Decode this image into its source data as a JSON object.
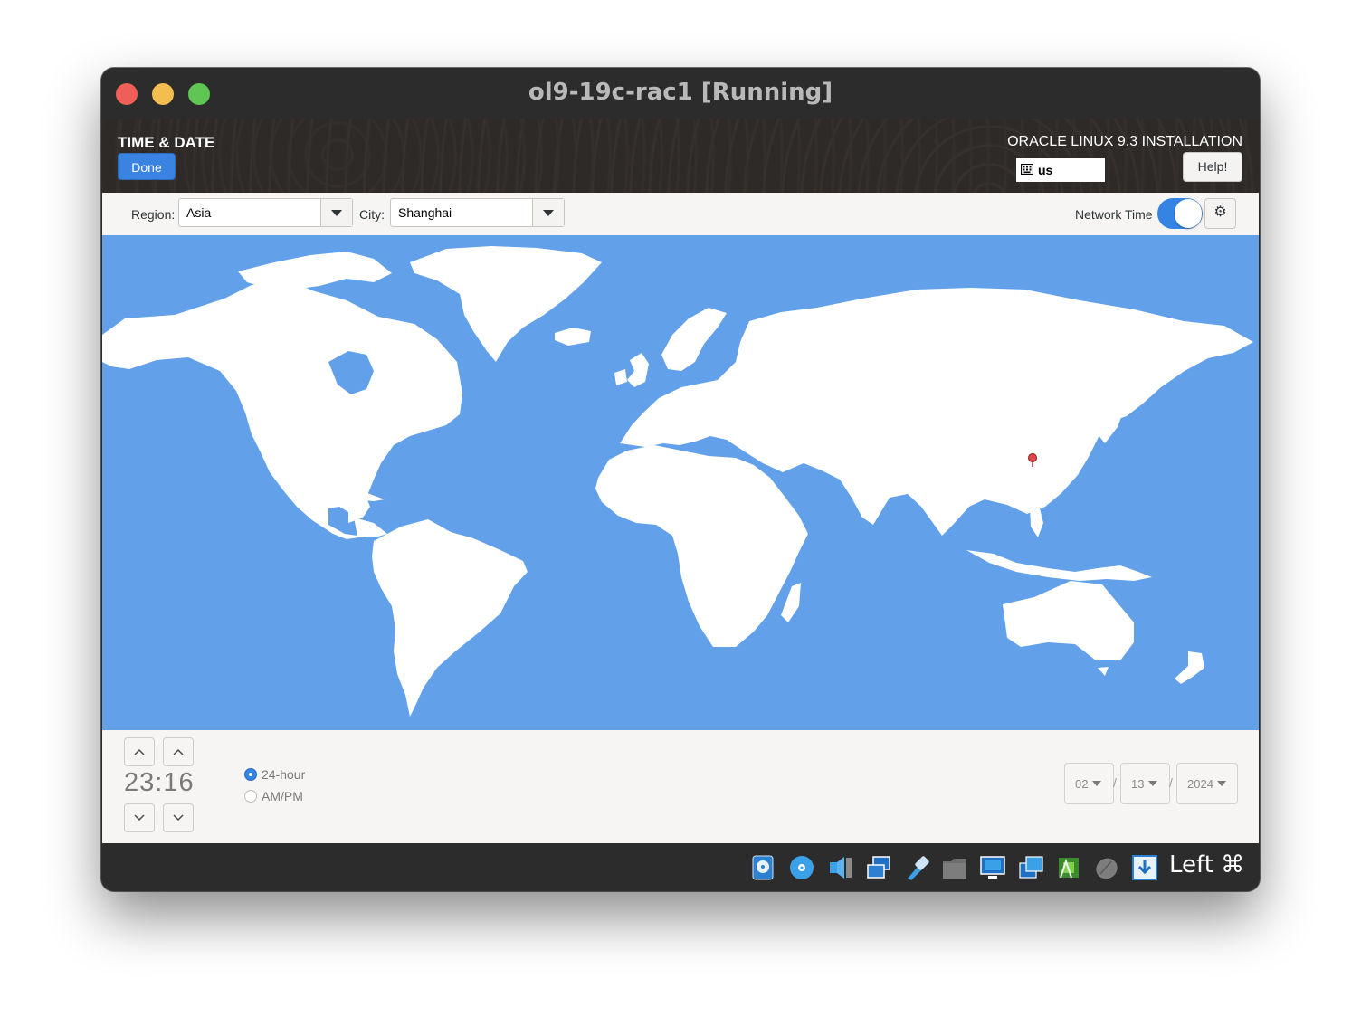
{
  "window": {
    "title": "ol9-19c-rac1 [Running]"
  },
  "header": {
    "spoke_title": "TIME & DATE",
    "done_label": "Done",
    "product_title": "ORACLE LINUX 9.3 INSTALLATION",
    "keyboard_layout": "us",
    "help_label": "Help!"
  },
  "toolbar": {
    "region_label": "Region:",
    "region_value": "Asia",
    "city_label": "City:",
    "city_value": "Shanghai",
    "network_time_label": "Network Time",
    "network_time_on": true
  },
  "map": {
    "selected_city": "Shanghai",
    "ocean_color": "#62a0ea",
    "land_color": "#ffffff",
    "pin_color": "#e0474c"
  },
  "time": {
    "hours": "23",
    "separator": ":",
    "minutes": "16",
    "format_24h_label": "24-hour",
    "format_ampm_label": "AM/PM",
    "selected_format": "24-hour"
  },
  "date": {
    "month": "02",
    "day": "13",
    "year": "2024",
    "separator": "/"
  },
  "statusbar": {
    "icons": [
      "hard-disk-icon",
      "optical-drive-icon",
      "audio-icon",
      "network-icon",
      "usb-icon",
      "shared-folder-icon",
      "display-icon",
      "recording-icon",
      "cpu-icon",
      "mouse-integration-icon",
      "download-icon"
    ],
    "host_key_label": "Left ⌘"
  },
  "colors": {
    "accent": "#3584e4",
    "titlebar": "#2c2c2c"
  }
}
